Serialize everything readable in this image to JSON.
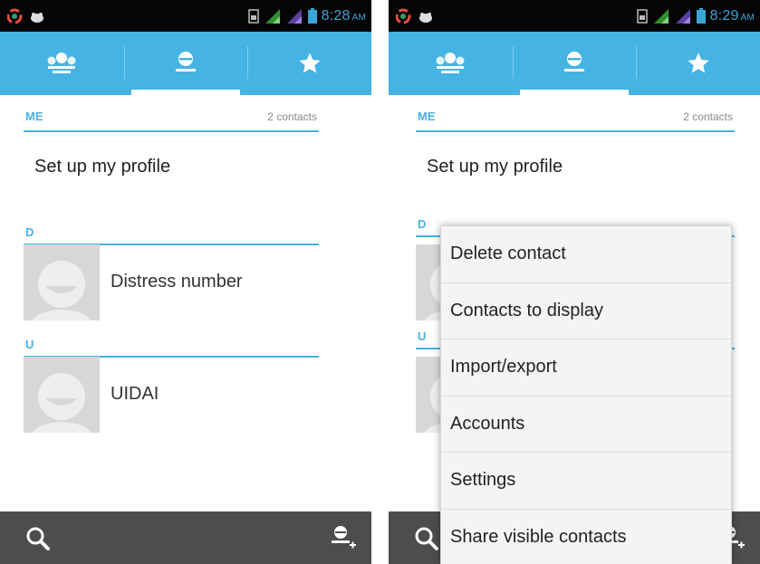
{
  "colors": {
    "accent": "#45b3e3",
    "status_bar": "#050505",
    "bottom_bar": "#4d4d4d",
    "menu_bg": "#f4f4f4"
  },
  "left_screen": {
    "status": {
      "time": "8:28",
      "ampm": "AM"
    },
    "tabs": [
      {
        "icon": "groups-icon"
      },
      {
        "icon": "contact-person-icon",
        "selected": true
      },
      {
        "icon": "star-icon"
      }
    ],
    "me_section": {
      "title": "ME",
      "count": "2 contacts",
      "profile_text": "Set up my profile"
    },
    "groups": [
      {
        "letter": "D",
        "contacts": [
          {
            "name": "Distress number"
          }
        ]
      },
      {
        "letter": "U",
        "contacts": [
          {
            "name": "UIDAI"
          }
        ]
      }
    ],
    "bottom_bar": {
      "left_icon": "search-icon",
      "right_icon": "add-contact-icon"
    }
  },
  "right_screen": {
    "status": {
      "time": "8:29",
      "ampm": "AM"
    },
    "me_section": {
      "title": "ME",
      "count": "2 contacts",
      "profile_text": "Set up my profile"
    },
    "groups": [
      {
        "letter": "D"
      },
      {
        "letter": "U"
      }
    ],
    "menu": {
      "items": [
        "Delete contact",
        "Contacts to display",
        "Import/export",
        "Accounts",
        "Settings",
        "Share visible contacts"
      ]
    }
  }
}
